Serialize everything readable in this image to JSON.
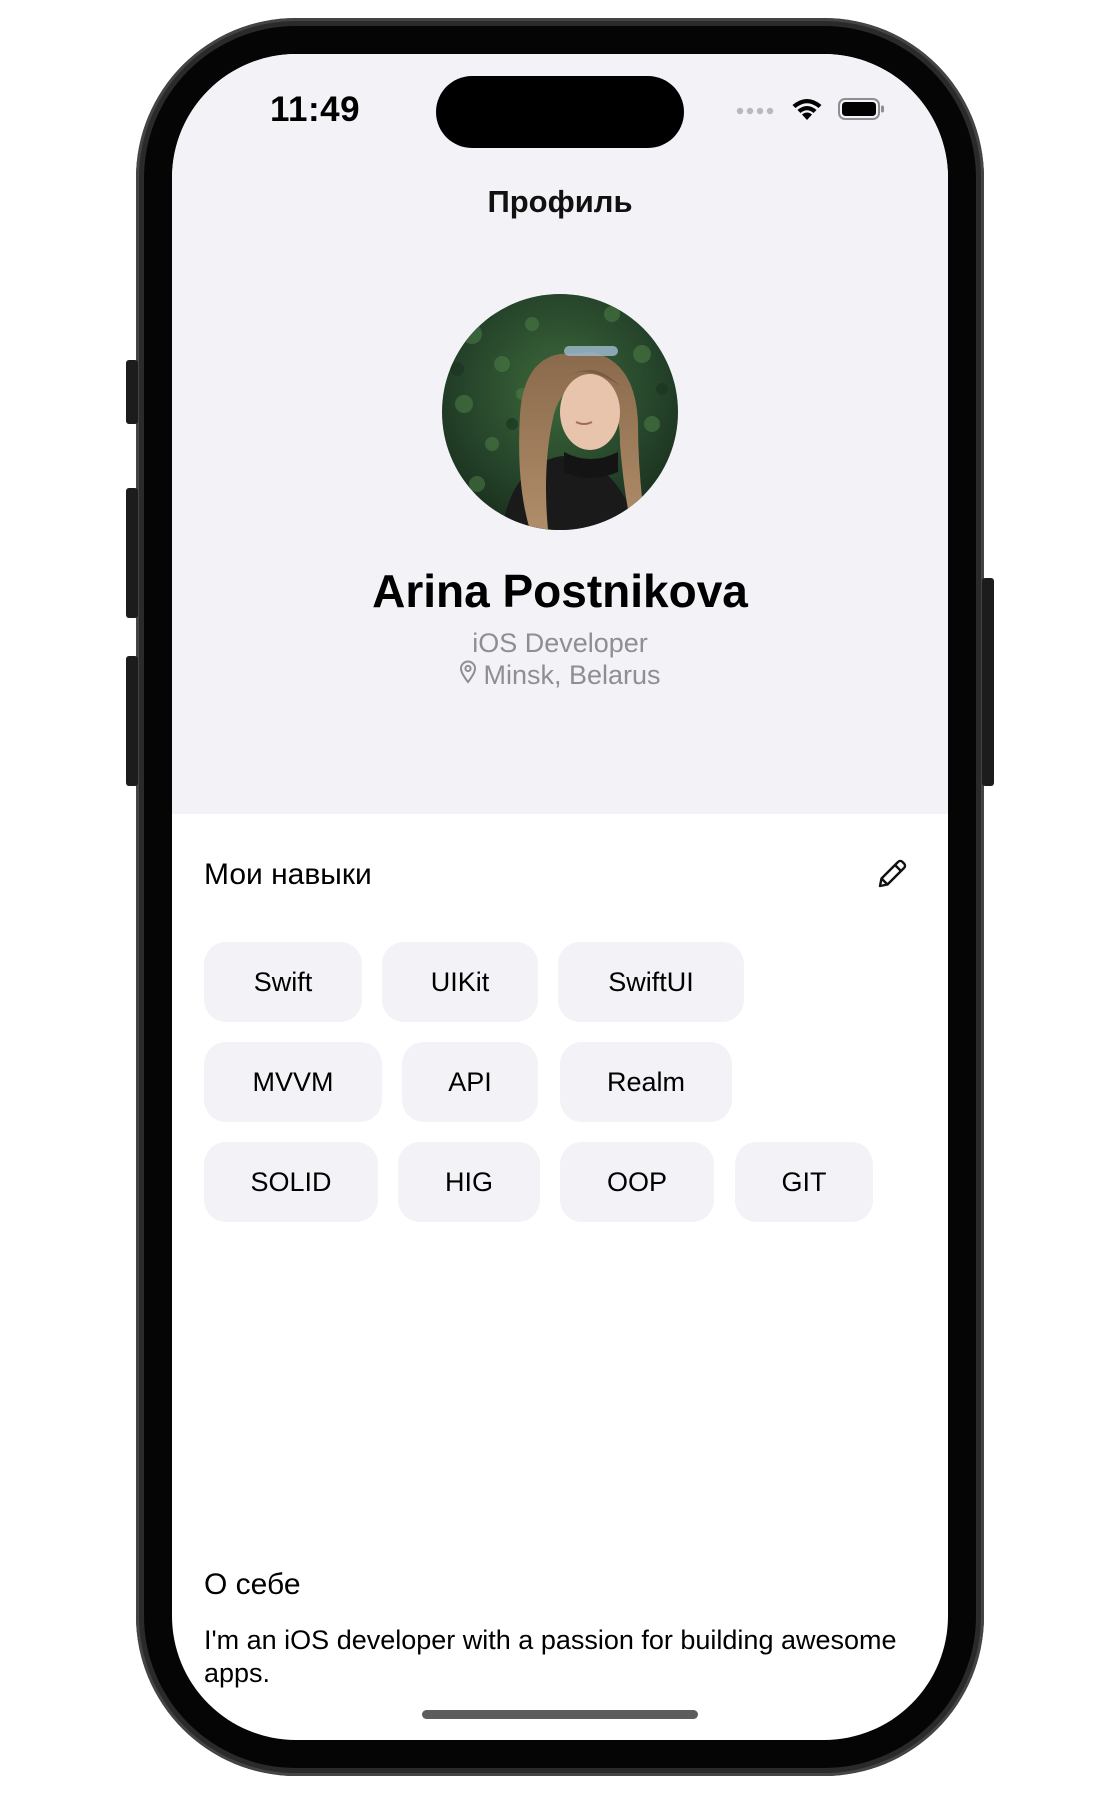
{
  "status_bar": {
    "time": "11:49",
    "icons": [
      "signal-dots-icon",
      "wifi-icon",
      "battery-icon"
    ]
  },
  "nav": {
    "title": "Профиль"
  },
  "profile": {
    "avatar_icon": "profile-photo",
    "name": "Arina Postnikova",
    "role": "iOS Developer",
    "location": "Minsk, Belarus",
    "location_icon": "map-pin-icon"
  },
  "skills": {
    "title": "Мои навыки",
    "edit_icon": "pencil-icon",
    "rows": [
      [
        "Swift",
        "UIKit",
        "SwiftUI"
      ],
      [
        "MVVM",
        "API",
        "Realm"
      ],
      [
        "SOLID",
        "HIG",
        "OOP",
        "GIT"
      ]
    ]
  },
  "about": {
    "title": "О себе",
    "text": "I'm an iOS developer with a passion for building awesome apps."
  },
  "colors": {
    "header_background": "#f2f2f7",
    "chip_background": "#f2f2f7",
    "secondary_text": "#8e8e93",
    "frame": "#2a2a2a"
  }
}
